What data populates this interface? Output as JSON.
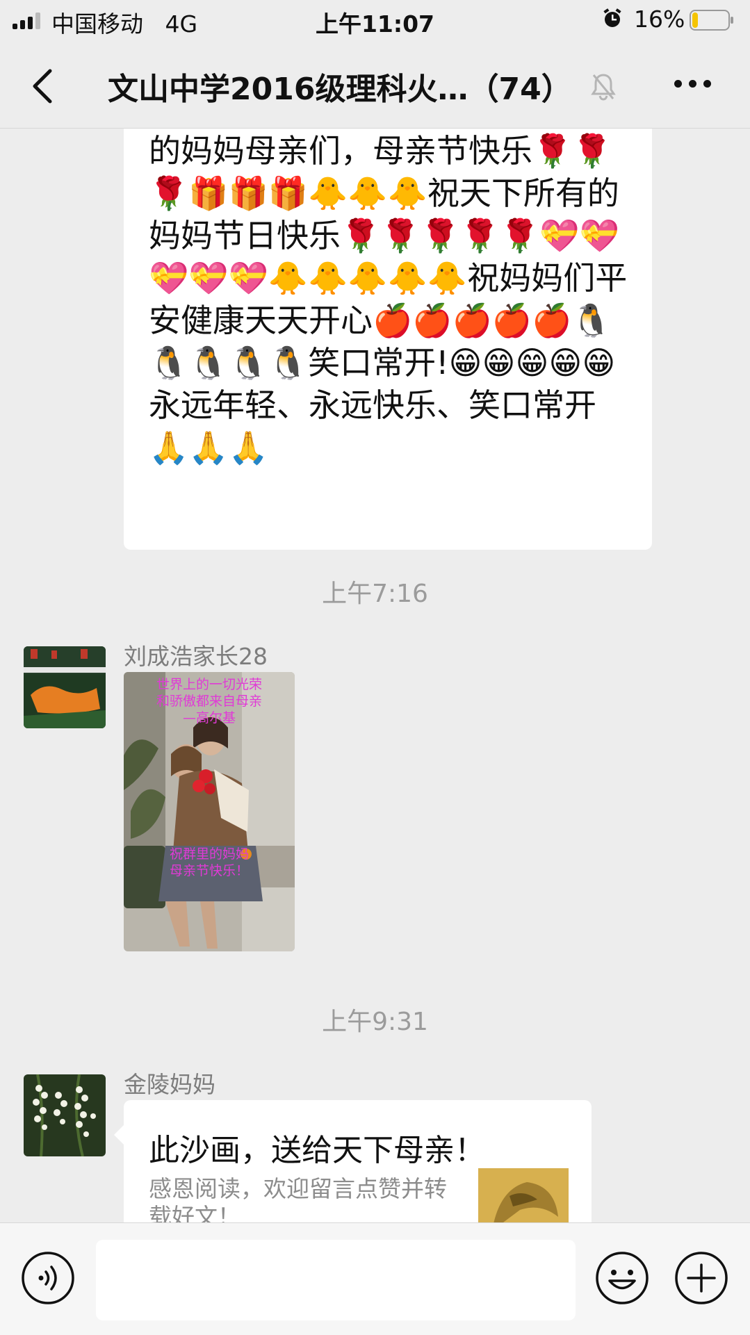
{
  "status_bar": {
    "carrier": "中国移动",
    "network": "4G",
    "time": "上午11:07",
    "battery": "16%",
    "battery_level": 0.16
  },
  "nav": {
    "title": "文山中学2016级理科火…（74）"
  },
  "messages": [
    {
      "type": "text",
      "text": "的妈妈母亲们，母亲节快乐🌹🌹🌹🎁🎁🎁🐥🐥🐥祝天下所有的妈妈节日快乐🌹🌹🌹🌹🌹💝💝💝💝💝🐥🐥🐥🐥🐥祝妈妈们平安健康天天开心🍎🍎🍎🍎🍎🐧🐧🐧🐧🐧笑口常开!😁😁😁😁😁永远年轻、永远快乐、笑口常开🙏🙏🙏"
    },
    {
      "type": "timestamp",
      "text": "上午7:16"
    },
    {
      "type": "image",
      "sender": "刘成浩家长28",
      "caption_top": [
        "世界上的一切光荣",
        "和骄傲都来自母亲",
        "—高尔基"
      ],
      "caption_bottom": [
        "祝群里的妈妈",
        "母亲节快乐！"
      ]
    },
    {
      "type": "timestamp",
      "text": "上午9:31"
    },
    {
      "type": "link",
      "sender": "金陵妈妈",
      "title": "此沙画，送给天下母亲！",
      "description": "感恩阅读，欢迎留言点赞并转载好文！"
    }
  ]
}
